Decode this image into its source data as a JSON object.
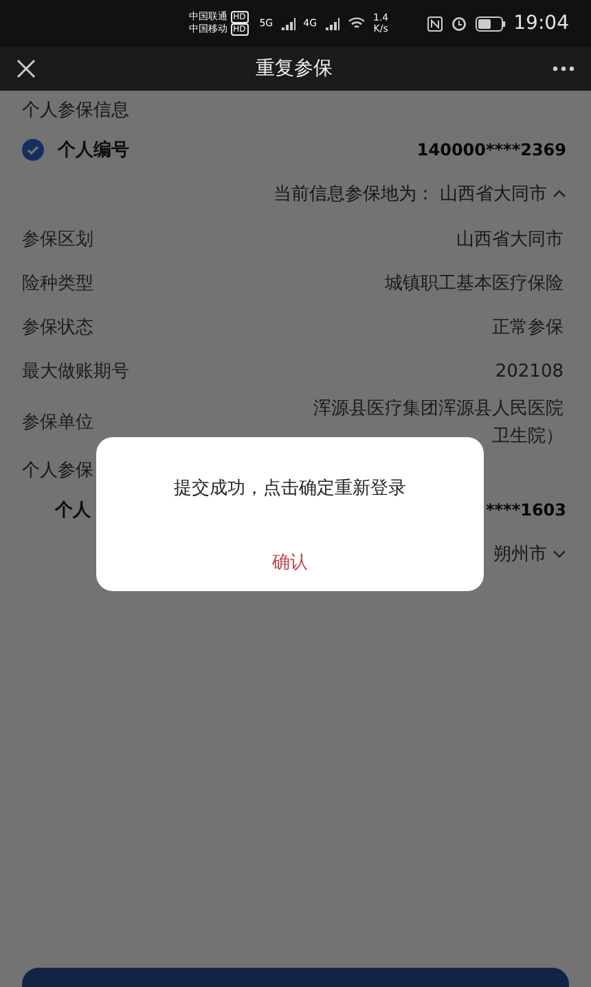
{
  "status_bar": {
    "carriers": [
      {
        "name": "中国联通",
        "badge": "HD"
      },
      {
        "name": "中国移动",
        "badge": "HD"
      }
    ],
    "networks": [
      "5G",
      "4G"
    ],
    "speed": "1.4",
    "speed_unit": "K/s",
    "time": "19:04"
  },
  "header": {
    "title": "重复参保"
  },
  "sections": [
    {
      "heading": "个人参保信息",
      "id_label": "个人编号",
      "id_value": "140000****2369",
      "checked": true,
      "location_label": "当前信息参保地为：",
      "location": "山西省大同市",
      "expanded": true,
      "fields": [
        {
          "label": "参保区划",
          "value": [
            "山西省大同市"
          ]
        },
        {
          "label": "险种类型",
          "value": [
            "城镇职工基本医疗保险"
          ]
        },
        {
          "label": "参保状态",
          "value": [
            "正常参保"
          ]
        },
        {
          "label": "最大做账期号",
          "value": [
            "202108"
          ]
        },
        {
          "label": "参保单位",
          "value": [
            "浑源县医疗集团浑源县人民医院",
            "卫生院）"
          ]
        }
      ]
    },
    {
      "heading": "个人参保",
      "id_label": "个人",
      "id_value": "****1603",
      "location": "朔州市",
      "expanded": false
    }
  ],
  "dialog": {
    "message": "提交成功，点击确定重新登录",
    "confirm": "确认"
  }
}
